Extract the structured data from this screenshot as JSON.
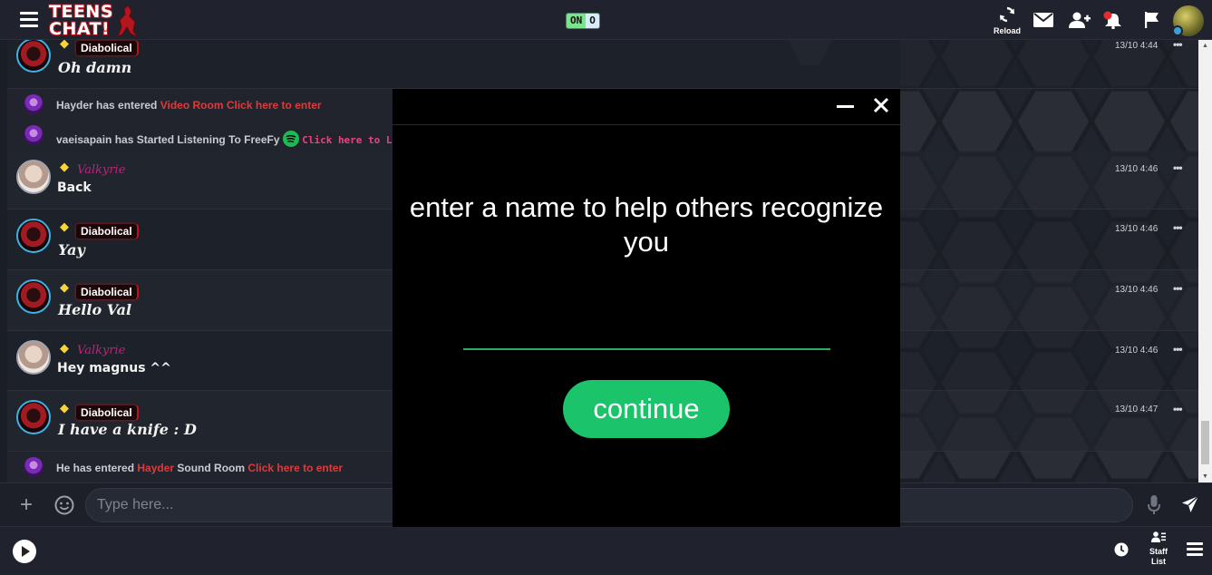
{
  "app": {
    "logo_line1": "TEENS",
    "logo_line2": "CHAT!",
    "toggle_on": "ON",
    "toggle_off": "O"
  },
  "topbar": {
    "reload_label": "Reload",
    "icons": [
      "menu-icon",
      "reload-icon",
      "mail-icon",
      "add-friend-icon",
      "notification-bell-icon",
      "flag-icon"
    ]
  },
  "messages": [
    {
      "type": "user",
      "user": "Diabolical",
      "text": "Oh damn",
      "time": "13/10 4:44"
    },
    {
      "type": "system",
      "actor": "Hayder",
      "action": " has entered ",
      "room": "Video Room",
      "link": " Click here to enter"
    },
    {
      "type": "system",
      "actor": "vaeisapain",
      "action": " has Started Listening To FreeFy ",
      "link": "Click here to List"
    },
    {
      "type": "user",
      "user": "Valkyrie",
      "text": "Back",
      "time": "13/10 4:46"
    },
    {
      "type": "user",
      "user": "Diabolical",
      "text": "Yay",
      "time": "13/10 4:46"
    },
    {
      "type": "user",
      "user": "Diabolical",
      "text": "Hello Val",
      "time": "13/10 4:46"
    },
    {
      "type": "user",
      "user": "Valkyrie",
      "text": "Hey magnus ^^",
      "time": "13/10 4:46"
    },
    {
      "type": "user",
      "user": "Diabolical",
      "text": "I have a knife : D",
      "time": "13/10 4:47"
    },
    {
      "type": "system",
      "actor": "He has entered ",
      "room": "Hayder",
      "action": " Sound Room ",
      "link": "Click here to enter"
    }
  ],
  "input": {
    "placeholder": "Type here..."
  },
  "bottombar": {
    "staff_label_1": "Staff",
    "staff_label_2": "List"
  },
  "modal": {
    "title": "enter a name to help others recognize you",
    "input_value": "",
    "continue_label": "continue",
    "accent_color": "#1bc46b"
  },
  "colors": {
    "background": "#1c1e26",
    "link_red": "#e0393a",
    "valkyrie_name": "#b5277a",
    "crown": "#f6d43a"
  }
}
